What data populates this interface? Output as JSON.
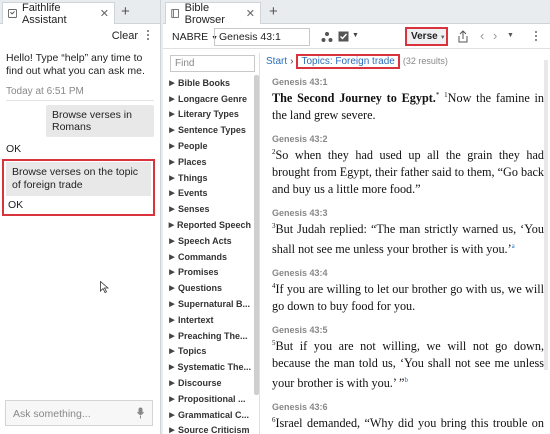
{
  "left_panel": {
    "tab_title": "Faithlife Assistant",
    "clear_label": "Clear",
    "chat": {
      "greeting": "Hello! Type “help” any time to find out what you can ask me.",
      "timestamp": "Today at 6:51 PM",
      "messages": [
        {
          "role": "user",
          "text": "Browse verses in Romans"
        },
        {
          "role": "assistant",
          "text": "OK"
        },
        {
          "role": "user",
          "text": "Browse verses on the topic of foreign trade"
        },
        {
          "role": "assistant",
          "text": "OK"
        }
      ]
    },
    "input_placeholder": "Ask something..."
  },
  "right_panel": {
    "tab_title": "Bible Browser",
    "version": "NABRE",
    "reference": "Genesis 43:1",
    "verse_button": "Verse",
    "filter_placeholder": "Find",
    "nav_items": [
      "Bible Books",
      "Longacre Genre",
      "Literary Types",
      "Sentence Types",
      "People",
      "Places",
      "Things",
      "Events",
      "Senses",
      "Reported Speech",
      "Speech Acts",
      "Commands",
      "Promises",
      "Questions",
      "Supernatural B...",
      "Intertext",
      "Preaching The...",
      "Topics",
      "Systematic The...",
      "Discourse",
      "Propositional ...",
      "Grammatical C...",
      "Source Criticism"
    ],
    "breadcrumb": {
      "start": "Start",
      "current": "Topics: Foreign trade",
      "count": "(32 results)"
    },
    "verses": [
      {
        "ref": "Genesis 43:1",
        "heading": "The Second Journey to Egypt.",
        "heading_note": "*",
        "num": "1",
        "text": "Now the famine in the land grew severe."
      },
      {
        "ref": "Genesis 43:2",
        "num": "2",
        "text": "So when they had used up all the grain they had brought from Egypt, their father said to them, “Go back and buy us a little more food.”"
      },
      {
        "ref": "Genesis 43:3",
        "num": "3",
        "text": "But Judah replied: “The man strictly warned us, ‘You shall not see me unless your brother is with you.’",
        "note": "a"
      },
      {
        "ref": "Genesis 43:4",
        "num": "4",
        "text": "If you are willing to let our brother go with us, we will go down to buy food for you."
      },
      {
        "ref": "Genesis 43:5",
        "num": "5",
        "text": "But if you are not willing, we will not go down, because the man told us, ‘You shall not see me unless your brother is with you.’ ”",
        "note": "b"
      },
      {
        "ref": "Genesis 43:6",
        "num": "6",
        "text": "Israel demanded, “Why did you bring this trouble on me by telling the man that you had another brother?”"
      }
    ]
  }
}
